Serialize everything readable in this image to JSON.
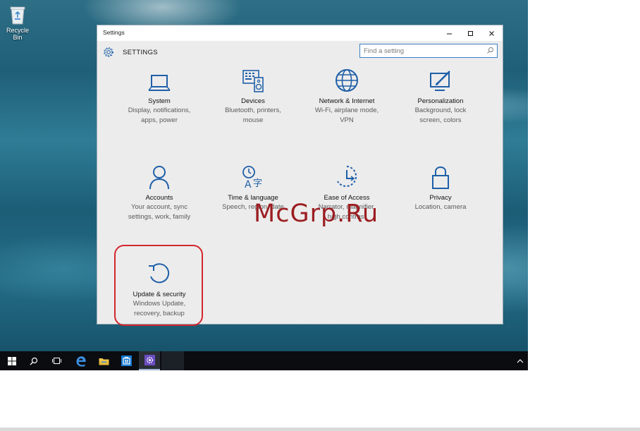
{
  "desktop": {
    "recycle_bin_label": "Recycle Bin"
  },
  "window": {
    "title": "Settings",
    "header_title": "SETTINGS",
    "search_placeholder": "Find a setting",
    "controls": [
      "minimize",
      "maximize",
      "close"
    ]
  },
  "tiles": [
    {
      "icon": "laptop-icon",
      "label": "System",
      "desc": "Display, notifications,\napps, power"
    },
    {
      "icon": "keyboard-speaker-icon",
      "label": "Devices",
      "desc": "Bluetooth, printers,\nmouse"
    },
    {
      "icon": "globe-icon",
      "label": "Network & Internet",
      "desc": "Wi-Fi, airplane mode,\nVPN"
    },
    {
      "icon": "paint-screen-icon",
      "label": "Personalization",
      "desc": "Background, lock\nscreen, colors"
    },
    {
      "icon": "person-icon",
      "label": "Accounts",
      "desc": "Your account, sync\nsettings, work, family"
    },
    {
      "icon": "time-language-icon",
      "label": "Time & language",
      "desc": "Speech, region, date"
    },
    {
      "icon": "ease-of-access-icon",
      "label": "Ease of Access",
      "desc": "Narrator, magnifier,\nhigh contrast"
    },
    {
      "icon": "lock-icon",
      "label": "Privacy",
      "desc": "Location, camera"
    },
    {
      "icon": "refresh-icon",
      "label": "Update & security",
      "desc": "Windows Update,\nrecovery, backup"
    }
  ],
  "highlighted_tile": "Update & security",
  "taskbar": {
    "buttons": [
      "start-button",
      "search-button",
      "task-view-button",
      "edge-button",
      "file-explorer-button",
      "store-button",
      "settings-button"
    ]
  },
  "watermark": "McGrp.Ru",
  "colors": {
    "icon_blue": "#1f5fa8",
    "highlight_red": "#d3262c",
    "search_border": "#3b7fc4",
    "taskbar": "#0a0c10",
    "watermark": "#9c1d21"
  }
}
